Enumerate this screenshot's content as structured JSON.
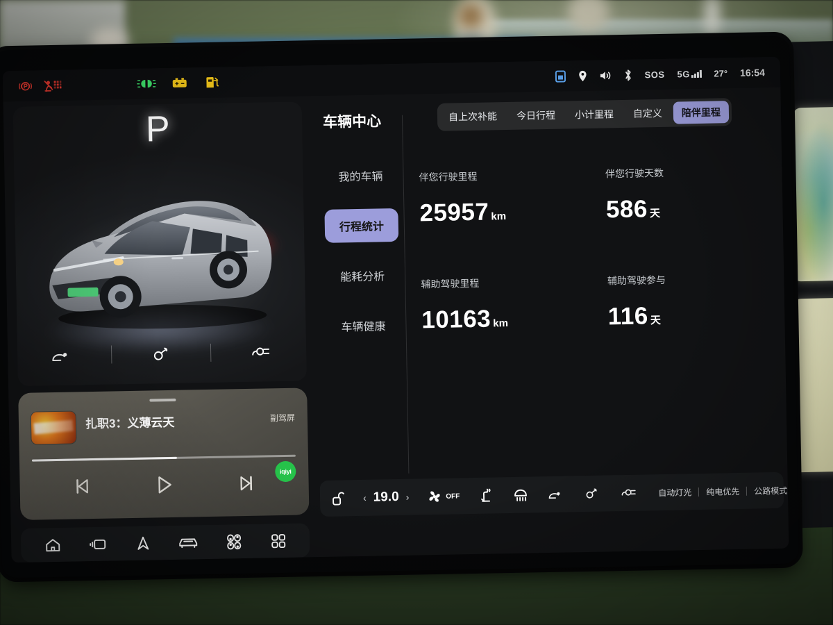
{
  "status_bar": {
    "left_telltales": [
      {
        "name": "parking-brake",
        "glyph": "((P))",
        "color": "#e4392f"
      },
      {
        "name": "airbag-warning",
        "glyph": "airbag",
        "color": "#e4392f"
      }
    ],
    "center_telltales": [
      {
        "name": "low-beam-headlight",
        "color": "#3ee06a"
      },
      {
        "name": "battery-warning",
        "color": "#f0c419"
      },
      {
        "name": "fuel-low",
        "color": "#f0c419"
      }
    ],
    "right_items": [
      {
        "name": "sim-card-icon",
        "label": ""
      },
      {
        "name": "location-icon",
        "label": ""
      },
      {
        "name": "volume-icon",
        "label": ""
      },
      {
        "name": "bluetooth-icon",
        "label": ""
      },
      {
        "name": "sos-icon",
        "label": "SOS"
      },
      {
        "name": "network-icon",
        "label": "5G"
      }
    ],
    "temperature": "27°",
    "clock": "16:54"
  },
  "left_panel": {
    "gear": "P",
    "car_model_alt": "silver SUV 3D model",
    "access_icons": [
      {
        "name": "tailgate-icon"
      },
      {
        "name": "fuel-cap-icon"
      },
      {
        "name": "charge-port-icon"
      }
    ]
  },
  "media": {
    "title": "扎职3：义薄云天",
    "source_label": "副驾屏",
    "progress_percent": 55,
    "badge_text": "iqiyi",
    "controls": [
      {
        "name": "previous-track-button"
      },
      {
        "name": "play-button"
      },
      {
        "name": "next-track-button"
      }
    ]
  },
  "dock": {
    "items": [
      {
        "name": "home-icon"
      },
      {
        "name": "media-icon"
      },
      {
        "name": "navigation-icon"
      },
      {
        "name": "car-icon"
      },
      {
        "name": "controls-icon"
      },
      {
        "name": "apps-grid-icon"
      }
    ]
  },
  "vehicle_center": {
    "title": "车辆中心",
    "nav": [
      {
        "label": "我的车辆",
        "active": false
      },
      {
        "label": "行程统计",
        "active": true
      },
      {
        "label": "能耗分析",
        "active": false
      },
      {
        "label": "车辆健康",
        "active": false
      }
    ],
    "tabs": [
      {
        "label": "自上次补能",
        "active": false
      },
      {
        "label": "今日行程",
        "active": false
      },
      {
        "label": "小计里程",
        "active": false
      },
      {
        "label": "自定义",
        "active": false
      },
      {
        "label": "陪伴里程",
        "active": true
      }
    ],
    "stats": [
      {
        "label": "伴您行驶里程",
        "value": "25957",
        "unit": "km"
      },
      {
        "label": "伴您行驶天数",
        "value": "586",
        "unit": "天"
      },
      {
        "label": "辅助驾驶里程",
        "value": "10163",
        "unit": "km"
      },
      {
        "label": "辅助驾驶参与",
        "value": "116",
        "unit": "天"
      }
    ]
  },
  "climate": {
    "lock_icon": "unlock-icon",
    "temperature": "19.0",
    "decrease_glyph": "‹",
    "increase_glyph": "›",
    "fan_state": "OFF",
    "quick_icons": [
      {
        "name": "seat-heat-icon"
      },
      {
        "name": "defrost-icon"
      },
      {
        "name": "tailgate-icon"
      },
      {
        "name": "fuel-cap-icon"
      },
      {
        "name": "charge-port-icon"
      }
    ],
    "modes": [
      {
        "label": "自动灯光"
      },
      {
        "label": "纯电优先"
      },
      {
        "label": "公路模式"
      }
    ]
  },
  "theme": {
    "accent_purple": "#9c9ddb",
    "screen_bg": "#111214",
    "panel_bg": "#17191b",
    "warning_red": "#e4392f",
    "warning_yellow": "#f0c419",
    "telltale_green": "#3ee06a",
    "badge_green": "#26c24a"
  }
}
